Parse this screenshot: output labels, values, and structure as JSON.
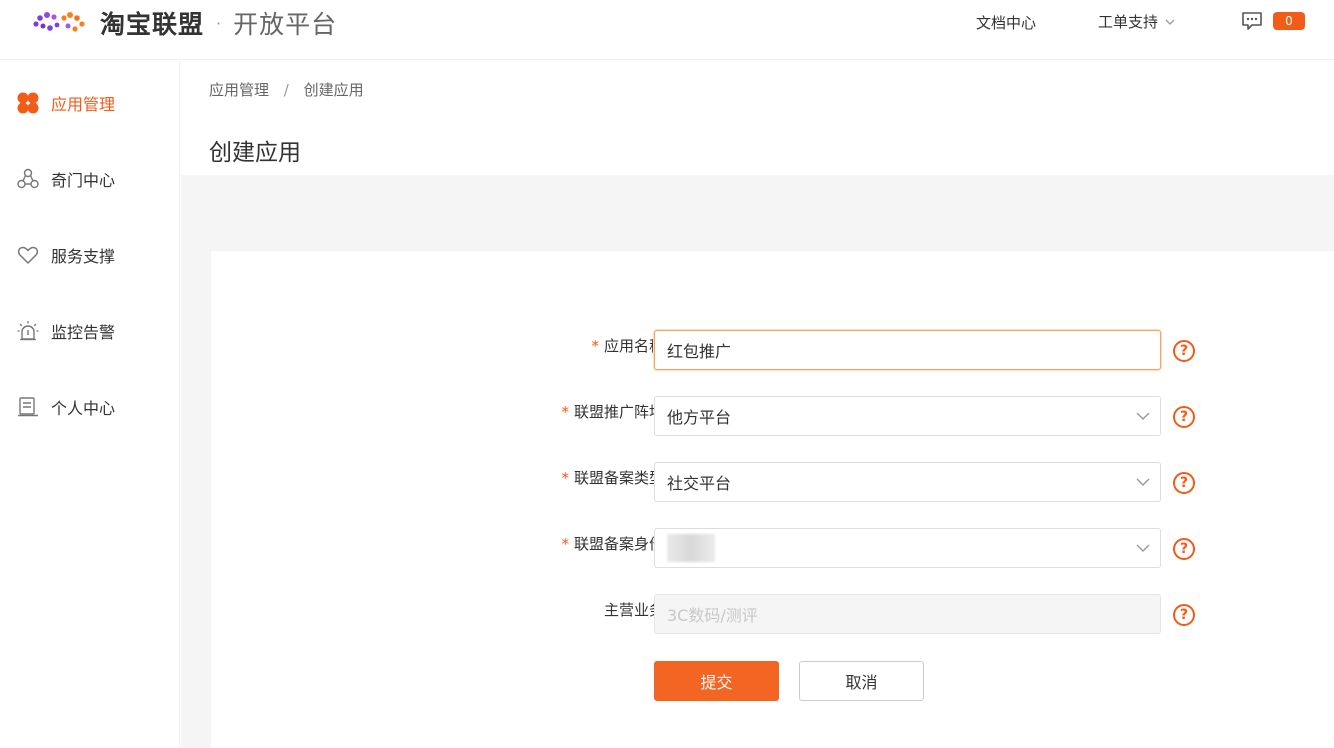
{
  "header": {
    "brand": "淘宝联盟",
    "separator": "·",
    "subtitle": "开放平台",
    "nav_docs": "文档中心",
    "nav_support": "工单支持",
    "message_count": "0"
  },
  "sidebar": {
    "items": [
      {
        "label": "应用管理",
        "icon": "apps-grid-icon",
        "active": true
      },
      {
        "label": "奇门中心",
        "icon": "network-icon",
        "active": false
      },
      {
        "label": "服务支撑",
        "icon": "heart-icon",
        "active": false
      },
      {
        "label": "监控告警",
        "icon": "alarm-light-icon",
        "active": false
      },
      {
        "label": "个人中心",
        "icon": "profile-card-icon",
        "active": false
      }
    ]
  },
  "breadcrumb": {
    "parent": "应用管理",
    "separator": "/",
    "current": "创建应用"
  },
  "page": {
    "title": "创建应用"
  },
  "form": {
    "app_name": {
      "label": "应用名称",
      "required": "*",
      "value": "红包推广"
    },
    "promo_site": {
      "label": "联盟推广阵地",
      "required": "*",
      "value": "他方平台"
    },
    "record_type": {
      "label": "联盟备案类型",
      "required": "*",
      "value": "社交平台"
    },
    "record_identity": {
      "label": "联盟备案身份",
      "required": "*",
      "value": ""
    },
    "main_business": {
      "label": "主营业务",
      "value": "3C数码/测评"
    },
    "help_glyph": "?",
    "submit": "提交",
    "cancel": "取消"
  },
  "colors": {
    "accent": "#f25c19",
    "button": "#f26522",
    "logo_purple": "#7b3fe4",
    "logo_orange": "#f5821f"
  }
}
